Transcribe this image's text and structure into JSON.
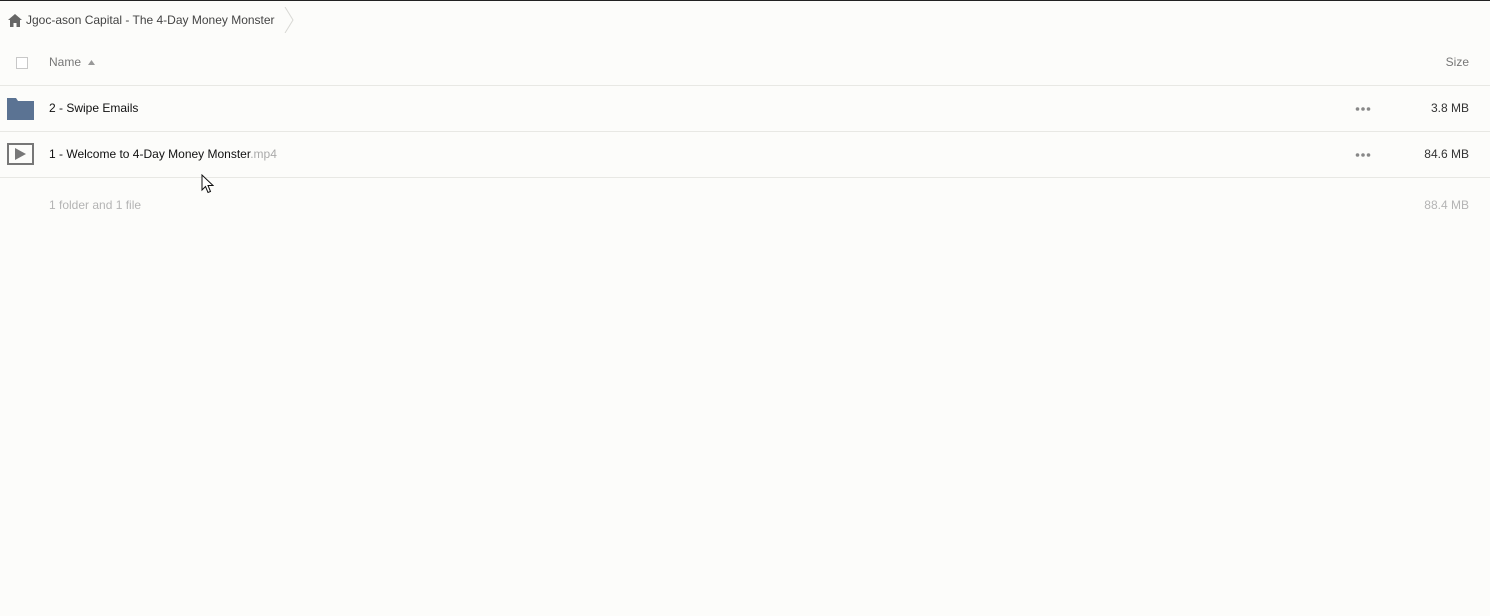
{
  "breadcrumb": {
    "home_icon": "home-icon",
    "label": "Jgoc-ason Capital - The 4-Day Money Monster"
  },
  "header": {
    "name_label": "Name",
    "size_label": "Size",
    "sort": "ascending"
  },
  "rows": [
    {
      "type": "folder",
      "icon": "folder-icon",
      "name": "2 - Swipe Emails",
      "ext": "",
      "size": "3.8 MB"
    },
    {
      "type": "video",
      "icon": "video-play-icon",
      "name": "1 - Welcome to 4-Day Money Monster",
      "ext": ".mp4",
      "size": "84.6 MB"
    }
  ],
  "summary": {
    "text": "1 folder and 1 file",
    "size": "88.4 MB"
  },
  "colors": {
    "background": "#fcfcfa",
    "folder": "#5b7393",
    "muted_text": "#b4b4b4"
  }
}
